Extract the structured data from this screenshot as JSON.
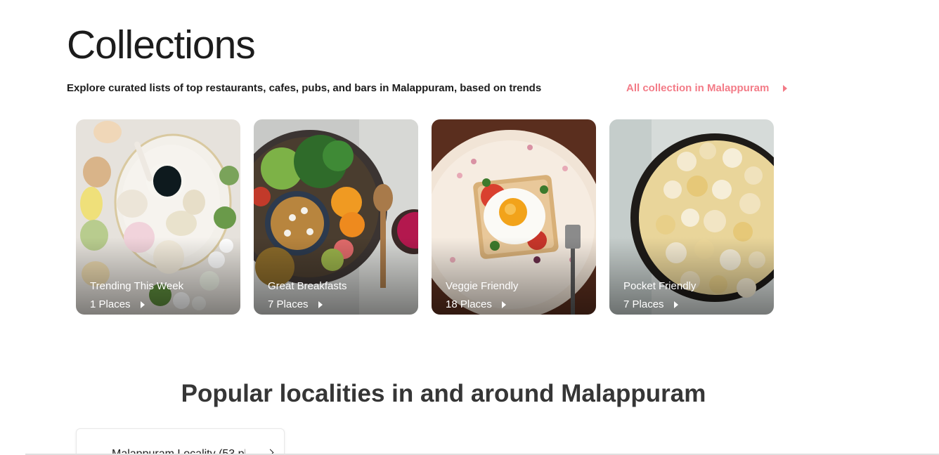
{
  "collections": {
    "title": "Collections",
    "subtitle": "Explore curated lists of top restaurants, cafes, pubs, and bars in Malappuram, based on trends",
    "all_link": "All collection in Malappuram",
    "cards": [
      {
        "name": "Trending This Week",
        "places": "1 Places",
        "image": "macarons-coffee"
      },
      {
        "name": "Great Breakfasts",
        "places": "7 Places",
        "image": "breakfast-bowl"
      },
      {
        "name": "Veggie Friendly",
        "places": "18 Places",
        "image": "egg-toast"
      },
      {
        "name": "Pocket Friendly",
        "places": "7 Places",
        "image": "popcorn"
      }
    ]
  },
  "localities": {
    "title": "Popular localities in and around Malappuram",
    "items": [
      {
        "label": "Malappuram Locality (53 pl"
      }
    ]
  },
  "colors": {
    "accent": "#ef4f5f",
    "text": "#1c1c1c"
  }
}
